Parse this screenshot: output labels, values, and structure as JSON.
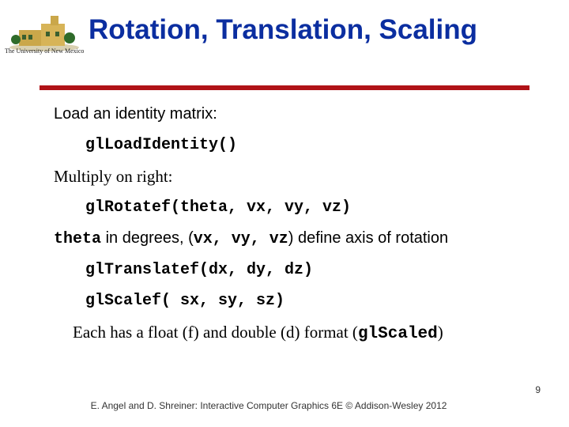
{
  "header": {
    "university": "The University of New Mexico",
    "title": "Rotation, Translation, Scaling"
  },
  "content": {
    "load_intro": "Load an identity matrix:",
    "load_code": "glLoadIdentity()",
    "mult_intro": "Multiply on right:",
    "rotate_code": "glRotatef(theta, vx, vy, vz)",
    "theta_word": "theta",
    "theta_line_mid": " in degrees, (",
    "theta_args": "vx, vy, vz",
    "theta_line_end": ") define axis of rotation",
    "translate_code": "glTranslatef(dx, dy, dz)",
    "scale_code": "glScalef( sx, sy, sz)",
    "note_pre": "Each has a float (f) and double (d) format (",
    "note_code": "glScaled",
    "note_post": ")"
  },
  "footer": {
    "credit": "E. Angel and D. Shreiner: Interactive Computer Graphics 6E © Addison-Wesley 2012",
    "page": "9"
  }
}
